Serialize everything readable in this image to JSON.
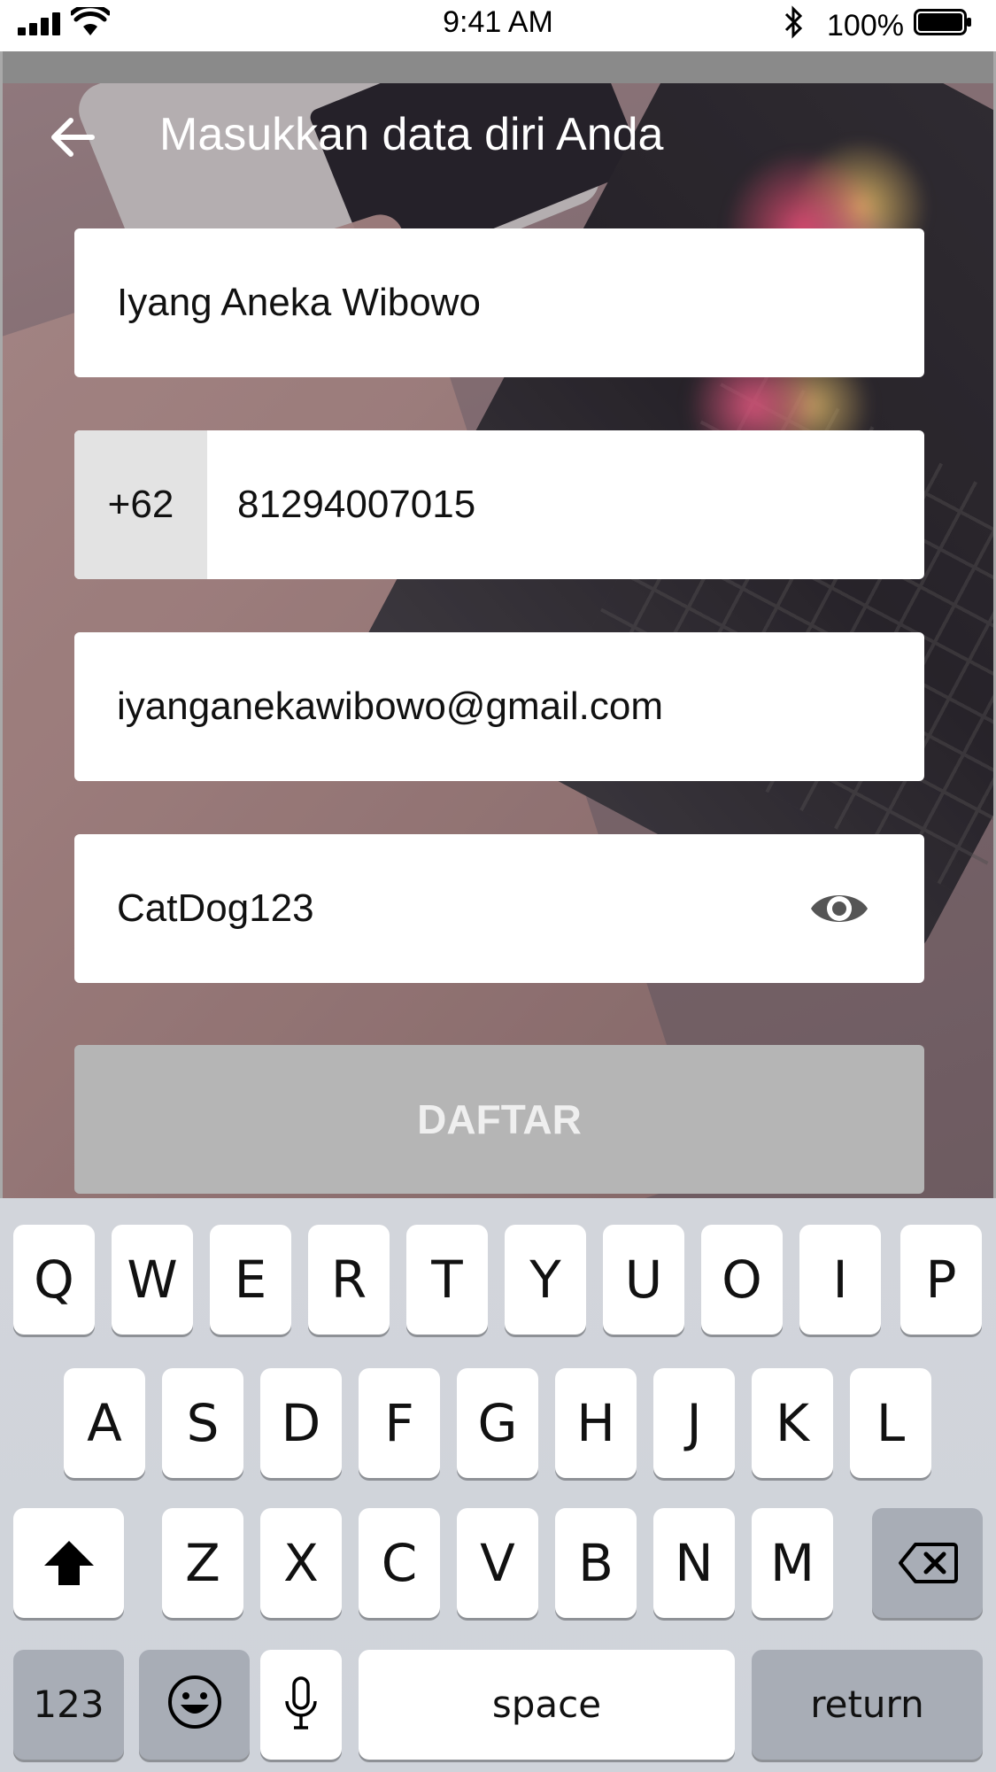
{
  "status_bar": {
    "time": "9:41 AM",
    "battery_percent": "100%",
    "battery_level": 1.0
  },
  "header": {
    "title": "Masukkan data diri Anda",
    "back_icon": "arrow-left-icon"
  },
  "form": {
    "name_value": "Iyang Aneka Wibowo",
    "phone_prefix": "+62",
    "phone_value": "81294007015",
    "email_value": "iyanganekawibowo@gmail.com",
    "password_value": "CatDog123",
    "password_toggle_icon": "eye-icon",
    "submit_label": "DAFTAR"
  },
  "keyboard": {
    "row1": [
      "Q",
      "W",
      "E",
      "R",
      "T",
      "Y",
      "U",
      "O",
      "I",
      "P"
    ],
    "row2": [
      "A",
      "S",
      "D",
      "F",
      "G",
      "H",
      "J",
      "K",
      "L"
    ],
    "row3": [
      "Z",
      "X",
      "C",
      "V",
      "B",
      "N",
      "M"
    ],
    "numbers_label": "123",
    "space_label": "space",
    "return_label": "return",
    "shift_icon": "shift-icon",
    "backspace_icon": "backspace-icon",
    "emoji_icon": "emoji-icon",
    "mic_icon": "microphone-icon"
  }
}
